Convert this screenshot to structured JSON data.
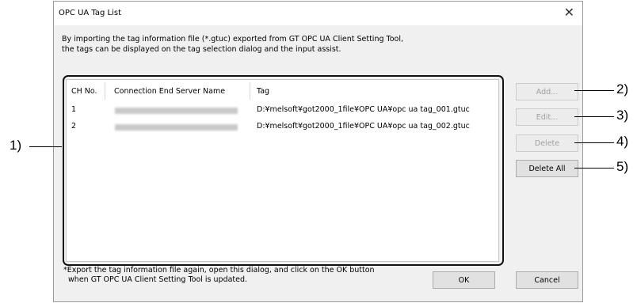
{
  "dialog": {
    "title": "OPC UA Tag List",
    "close_glyph": "✕",
    "description": "By importing the tag information file (*.gtuc) exported from GT OPC UA Client Setting Tool,\nthe tags can be displayed on the tag selection dialog and the input assist."
  },
  "table": {
    "columns": [
      "CH No.",
      "Connection End Server Name",
      "Tag"
    ],
    "rows": [
      {
        "ch": "1",
        "tag": "D:¥melsoft¥got2000_1file¥OPC UA¥opc ua tag_001.gtuc"
      },
      {
        "ch": "2",
        "tag": "D:¥melsoft¥got2000_1file¥OPC UA¥opc ua tag_002.gtuc"
      }
    ]
  },
  "buttons": {
    "add": "Add...",
    "edit": "Edit...",
    "delete": "Delete",
    "delete_all": "Delete All",
    "ok": "OK",
    "cancel": "Cancel"
  },
  "note": "*Export the tag information file again, open this dialog, and click on the OK button\n  when GT OPC UA Client Setting Tool is updated.",
  "callouts": [
    "1)",
    "2)",
    "3)",
    "4)",
    "5)"
  ]
}
